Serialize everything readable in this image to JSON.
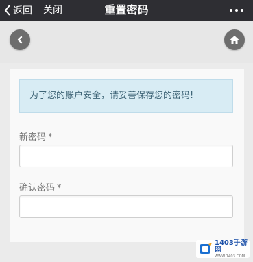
{
  "topbar": {
    "back_label": "返回",
    "close_label": "关闭",
    "title": "重置密码"
  },
  "notice": {
    "text": "为了您的账户安全，请妥善保存您的密码!"
  },
  "form": {
    "new_password_label": "新密码",
    "confirm_password_label": "确认密码",
    "required_mark": "*"
  },
  "watermark": {
    "text": "1403手游网",
    "subtext": "WWW.1403.COM"
  },
  "icons": {
    "back": "chevron-left-icon",
    "more": "more-horizontal-icon",
    "nav_back": "circle-back-icon",
    "home": "home-icon"
  },
  "colors": {
    "topbar": "#2e2e33",
    "background": "#ebebeb",
    "notice_bg": "#d8ecf4",
    "notice_text": "#3f6577",
    "nav_button": "#6d6d6d"
  }
}
